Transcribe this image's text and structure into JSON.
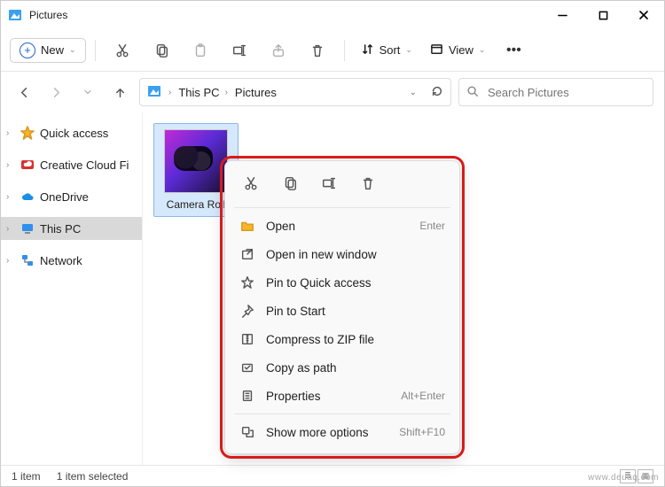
{
  "window": {
    "title": "Pictures"
  },
  "toolbar": {
    "new_label": "New",
    "sort_label": "Sort",
    "view_label": "View"
  },
  "breadcrumb": {
    "root": "This PC",
    "current": "Pictures"
  },
  "search": {
    "placeholder": "Search Pictures"
  },
  "sidebar": {
    "items": [
      {
        "label": "Quick access"
      },
      {
        "label": "Creative Cloud Fi"
      },
      {
        "label": "OneDrive"
      },
      {
        "label": "This PC"
      },
      {
        "label": "Network"
      }
    ]
  },
  "content": {
    "items": [
      {
        "label": "Camera Roll"
      }
    ]
  },
  "contextmenu": {
    "items": [
      {
        "label": "Open",
        "shortcut": "Enter"
      },
      {
        "label": "Open in new window",
        "shortcut": ""
      },
      {
        "label": "Pin to Quick access",
        "shortcut": ""
      },
      {
        "label": "Pin to Start",
        "shortcut": ""
      },
      {
        "label": "Compress to ZIP file",
        "shortcut": ""
      },
      {
        "label": "Copy as path",
        "shortcut": ""
      },
      {
        "label": "Properties",
        "shortcut": "Alt+Enter"
      }
    ],
    "more": {
      "label": "Show more options",
      "shortcut": "Shift+F10"
    }
  },
  "statusbar": {
    "count": "1 item",
    "selected": "1 item selected"
  },
  "watermark": "www.deuaq.com"
}
